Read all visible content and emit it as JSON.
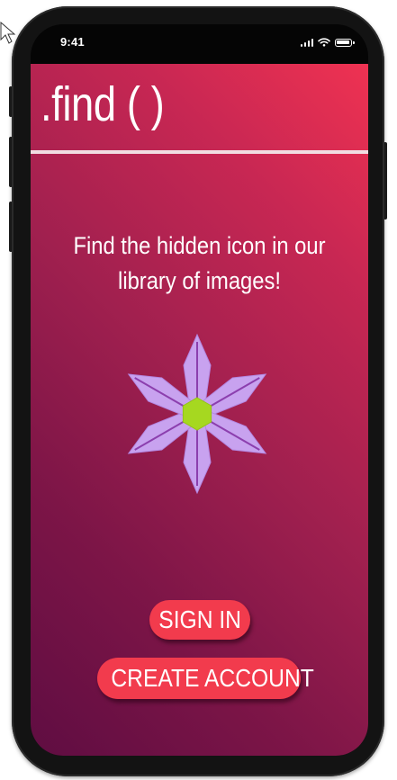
{
  "status_bar": {
    "time": "9:41",
    "icons": [
      "signal-bars-icon",
      "wifi-icon",
      "battery-icon"
    ]
  },
  "app": {
    "title": ".find ( )",
    "intro_text": "Find the hidden icon in our library of images!",
    "feature_icon": "six-petal-flower-icon",
    "sign_in_label": "SIGN IN",
    "create_account_label": "CREATE ACCOUNT"
  },
  "colors": {
    "gradient_top_right": "#ef3252",
    "gradient_bottom_left": "#5f0d42",
    "button_background": "#f23b4d",
    "petal_color": "#c8a2ef",
    "petal_vein_color": "#8c3fae",
    "flower_center_color": "#a6d820",
    "divider_color": "#f1dde2"
  }
}
